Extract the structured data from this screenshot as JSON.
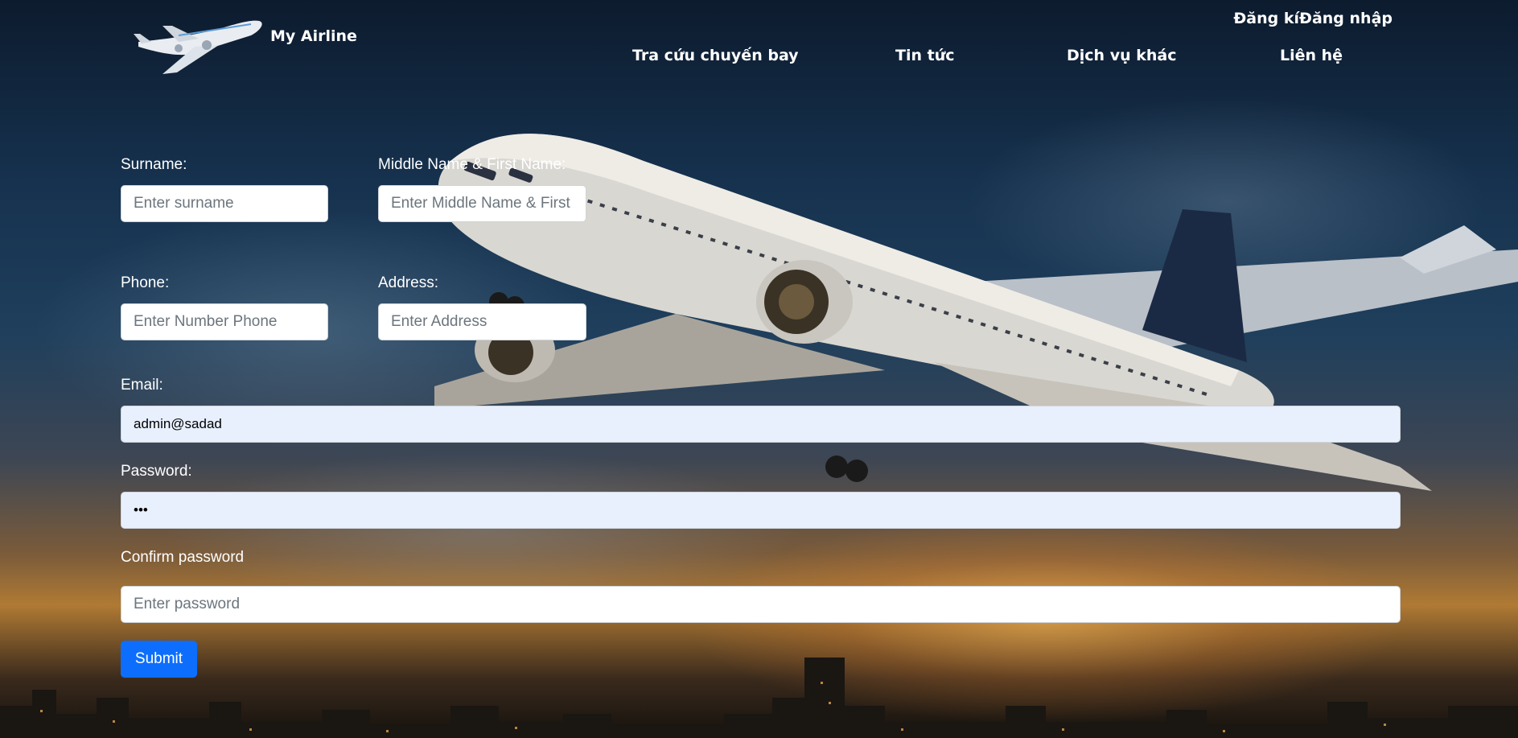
{
  "header": {
    "brand": "My Airline",
    "auth": {
      "register": "Đăng kí",
      "login": "Đăng nhập"
    },
    "nav": [
      {
        "label": "Tra cứu chuyến bay"
      },
      {
        "label": "Tin tức"
      },
      {
        "label": "Dịch vụ khác"
      },
      {
        "label": "Liên hệ"
      }
    ]
  },
  "form": {
    "surname": {
      "label": "Surname:",
      "placeholder": "Enter surname",
      "value": ""
    },
    "firstname": {
      "label": "Middle Name & First Name:",
      "placeholder": "Enter Middle Name & First Name",
      "value": ""
    },
    "phone": {
      "label": "Phone:",
      "placeholder": "Enter Number Phone",
      "value": ""
    },
    "address": {
      "label": "Address:",
      "placeholder": "Enter Address",
      "value": ""
    },
    "email": {
      "label": "Email:",
      "placeholder": "",
      "value": "admin@sadad"
    },
    "password": {
      "label": "Password:",
      "placeholder": "",
      "value": "•••"
    },
    "confirm": {
      "label": "Confirm password",
      "placeholder": "Enter password",
      "value": ""
    },
    "submit_label": "Submit"
  },
  "colors": {
    "primary": "#0d6efd",
    "autofill": "#e8f0fe",
    "text_light": "#ffffff"
  }
}
